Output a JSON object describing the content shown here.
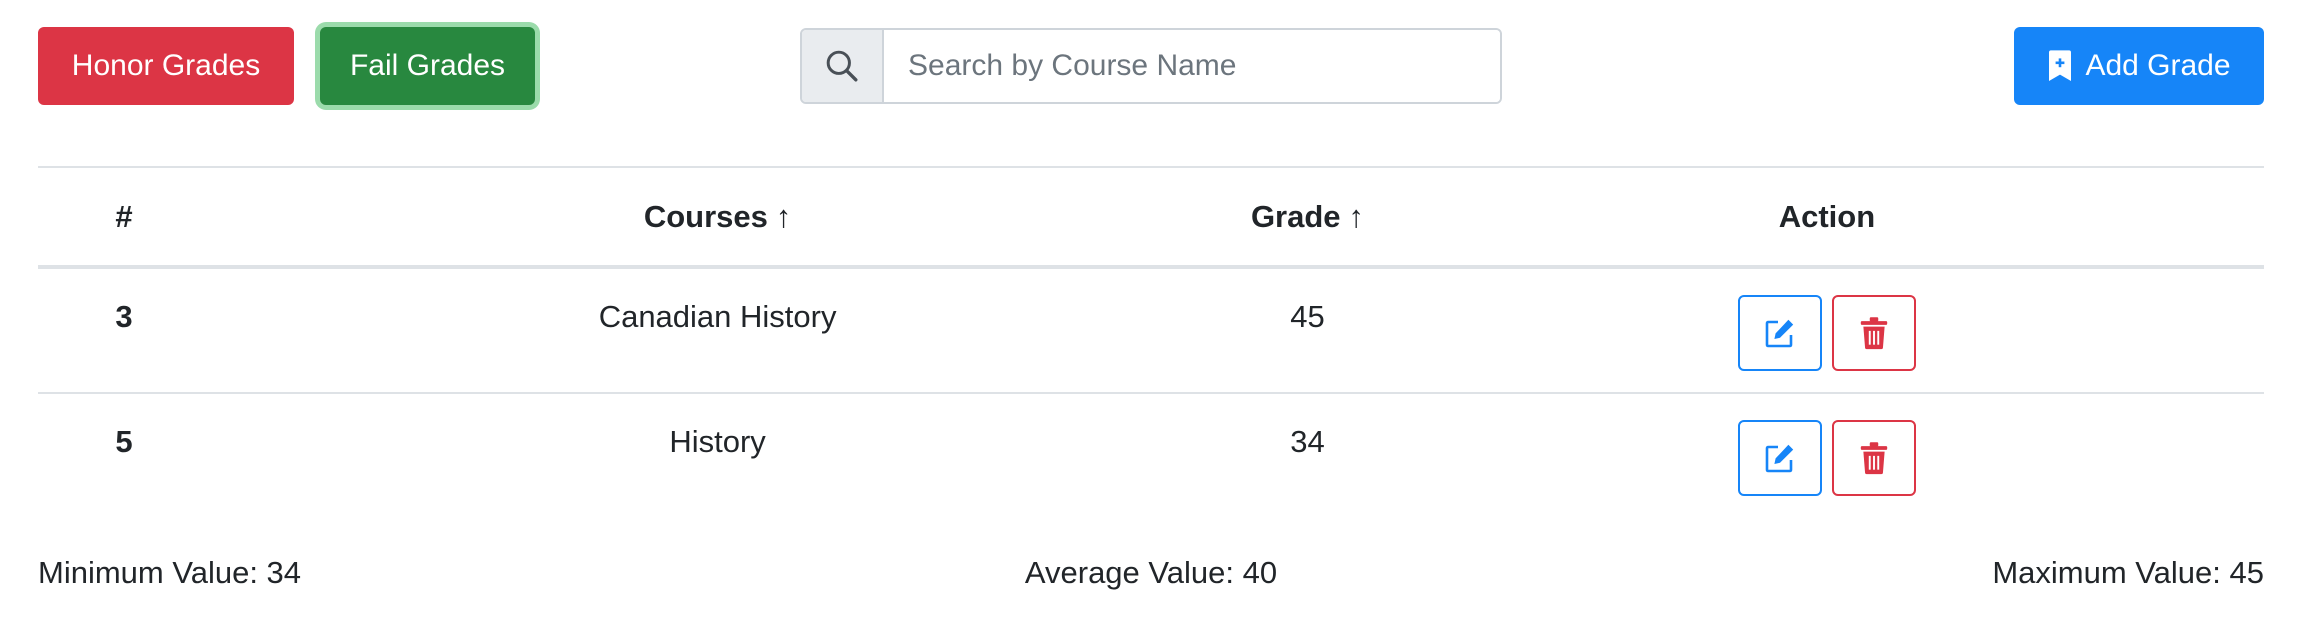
{
  "toolbar": {
    "honor_label": "Honor Grades",
    "fail_label": "Fail Grades",
    "add_label": "Add Grade",
    "search_placeholder": "Search by Course Name",
    "search_value": ""
  },
  "colors": {
    "honor": "#dc3545",
    "fail": "#28883f",
    "add": "#1685f8",
    "edit": "#1685f8",
    "delete": "#dc3545"
  },
  "icons": {
    "search": "search-icon",
    "add": "bookmark-plus-icon",
    "edit": "pencil-square-icon",
    "delete": "trash-icon"
  },
  "table": {
    "headers": {
      "num": "#",
      "course": "Courses",
      "course_sort": "↑",
      "grade": "Grade",
      "grade_sort": "↑",
      "action": "Action"
    },
    "rows": [
      {
        "num": "3",
        "course": "Canadian History",
        "grade": "45"
      },
      {
        "num": "5",
        "course": "History",
        "grade": "34"
      }
    ]
  },
  "stats": {
    "min": "Minimum Value: 34",
    "avg": "Average Value: 40",
    "max": "Maximum Value: 45"
  }
}
